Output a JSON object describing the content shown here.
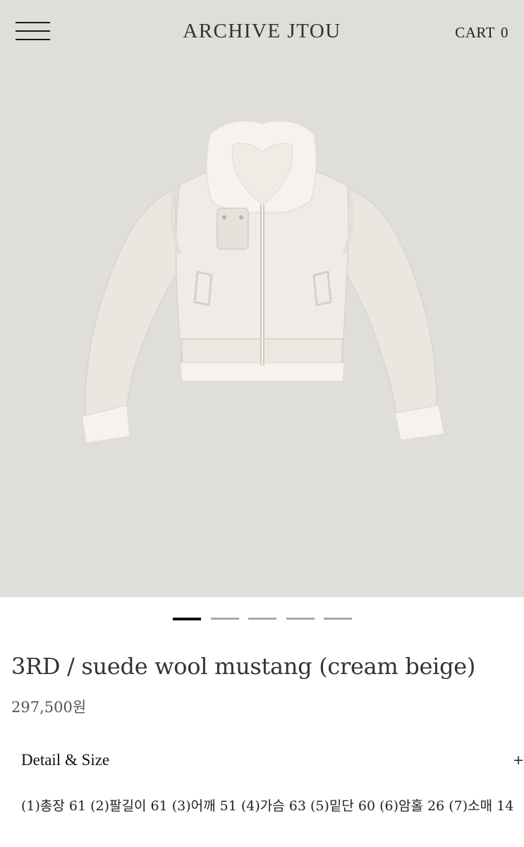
{
  "header": {
    "brand": "ARCHIVE JTOU",
    "cart_label": "CART",
    "cart_count": "0",
    "menu_icon": "hamburger-menu-icon"
  },
  "gallery": {
    "image": "cream beige suede wool mustang jacket product photo",
    "total_slides": 5,
    "active_slide": 1
  },
  "product": {
    "title": "3RD / suede wool mustang (cream beige)",
    "price": "297,500원"
  },
  "detail": {
    "label": "Detail & Size",
    "toggle_icon": "plus-icon",
    "toggle_symbol": "+",
    "text": "(1)총장 61 (2)팔길이 61 (3)어깨 51 (4)가슴 63 (5)밑단 60 (6)암홀 26 (7)소매 14"
  },
  "colors": {
    "background": "#dfdedb",
    "jacket": "#eeebe6",
    "fur": "#f6f3ee"
  }
}
